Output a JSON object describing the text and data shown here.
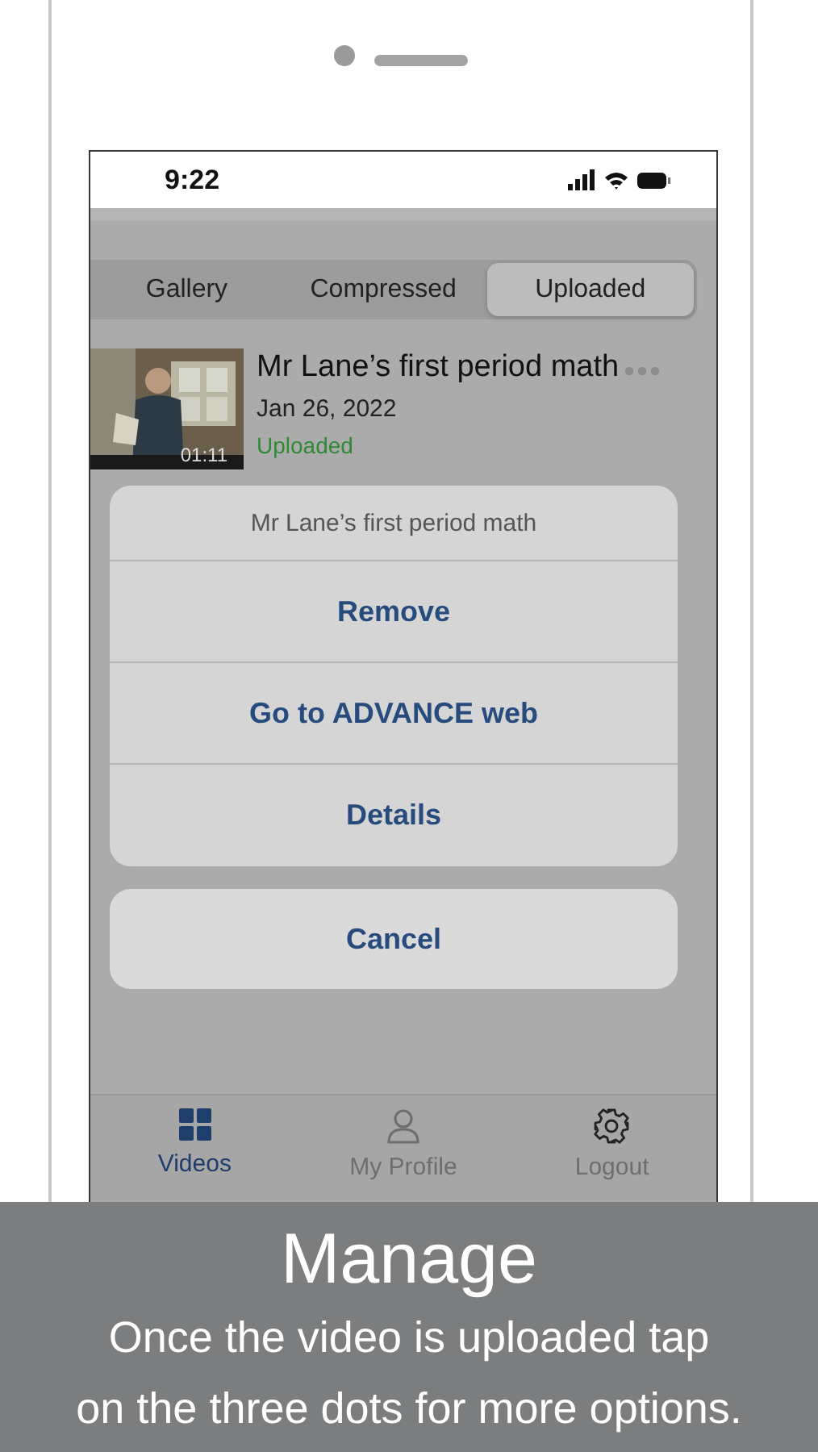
{
  "status_bar": {
    "time": "9:22"
  },
  "segments": [
    {
      "label": "Gallery",
      "selected": false
    },
    {
      "label": "Compressed",
      "selected": false
    },
    {
      "label": "Uploaded",
      "selected": true
    }
  ],
  "video": {
    "duration": "01:11",
    "title": "Mr Lane’s first period math",
    "date": "Jan 26, 2022",
    "status": "Uploaded"
  },
  "action_sheet": {
    "title": "Mr Lane’s first period math",
    "options": [
      "Remove",
      "Go to ADVANCE web",
      "Details"
    ],
    "cancel": "Cancel"
  },
  "tab_bar": [
    {
      "label": "Videos",
      "kind": "grid",
      "selected": true
    },
    {
      "label": "My Profile",
      "kind": "person",
      "selected": false
    },
    {
      "label": "Logout",
      "kind": "gear",
      "selected": false
    }
  ],
  "caption": {
    "title": "Manage",
    "lines": [
      "Once the video is uploaded tap",
      "on the three dots for more options."
    ]
  }
}
